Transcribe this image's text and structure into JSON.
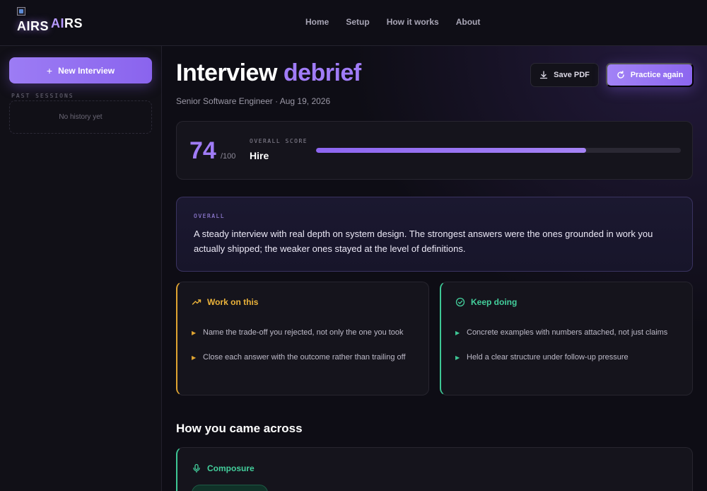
{
  "brand": {
    "logo_alt": "AIRS",
    "name_prefix": "AI",
    "name_suffix": "RS"
  },
  "nav": [
    "Home",
    "Setup",
    "How it works",
    "About"
  ],
  "sidebar": {
    "new_button": "New Interview",
    "past_label": "PAST SESSIONS",
    "empty_history": "No history yet"
  },
  "header": {
    "title_main": "Interview",
    "title_accent": "debrief",
    "subtitle": "Senior Software Engineer · Aug 19, 2026",
    "save_label": "Save PDF",
    "practice_label": "Practice again"
  },
  "score": {
    "value": "74",
    "max": "/100",
    "label": "OVERALL SCORE",
    "verdict": "Hire",
    "fraction": 0.74
  },
  "overall": {
    "label": "OVERALL",
    "text": "A steady interview with real depth on system design. The strongest answers were the ones grounded in work you actually shipped; the weaker ones stayed at the level of definitions."
  },
  "work_on": {
    "title": "Work on this",
    "items": [
      "Name the trade-off you rejected, not only the one you took",
      "Close each answer with the outcome rather than trailing off"
    ]
  },
  "keep_doing": {
    "title": "Keep doing",
    "items": [
      "Concrete examples with numbers attached, not just claims",
      "Held a clear structure under follow-up pressure"
    ]
  },
  "came_across": {
    "title": "How you came across",
    "composure_title": "Composure"
  },
  "colors": {
    "accent": "#a07cf7",
    "warning": "#e0a431",
    "success": "#3ec795",
    "background": "#0c0b12"
  },
  "icons": {
    "save": "download-icon",
    "practice": "refresh-icon",
    "work_on": "trending-up-icon",
    "keep_doing": "check-circle-icon",
    "composure": "microphone-icon",
    "bullet": "triangle-right-icon"
  }
}
